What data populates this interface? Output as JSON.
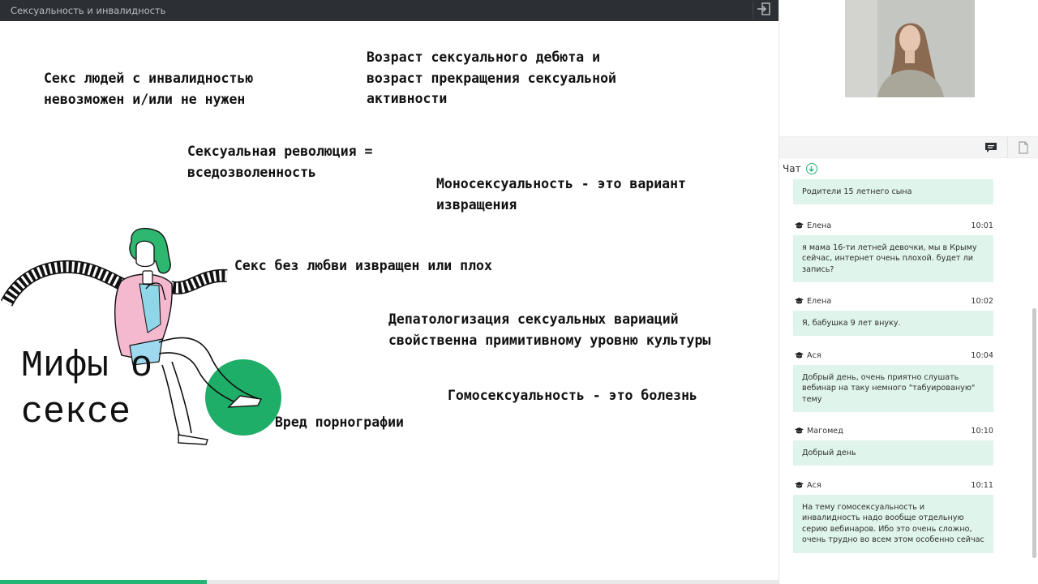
{
  "app": {
    "title": "Сексуальность и инвалидность"
  },
  "slide": {
    "heading": "Мифы о\nсексе",
    "myths": [
      "Секс людей с инвалидностью\nневозможен и/или не нужен",
      "Возраст сексуального дебюта и\nвозраст прекращения сексуальной\nактивности",
      "Сексуальная революция =\nвседозволенность",
      "Моносексуальность - это вариант\nизвращения",
      "Секс без любви извращен или плох",
      "Депатологизация сексуальных вариаций\nсвойственна примитивному уровню культуры",
      "Гомосексуальность - это болезнь",
      "Вред порнографии"
    ],
    "progress": 0.266
  },
  "sidebar": {
    "chat_label": "Чат",
    "tabs": {
      "chat_icon": "chat-icon",
      "files_icon": "file-icon"
    },
    "messages": [
      {
        "author": "",
        "time": "",
        "text": "Родители 15 летнего сына"
      },
      {
        "author": "Елена",
        "time": "10:01",
        "text": "я мама 16-ти летней девочки, мы в Крыму сейчас, интернет очень плохой. будет ли запись?"
      },
      {
        "author": "Елена",
        "time": "10:02",
        "text": "Я, бабушка 9 лет внуку."
      },
      {
        "author": "Ася",
        "time": "10:04",
        "text": "Добрый день, очень приятно слушать вебинар на таку немного \"табуированую\" тему"
      },
      {
        "author": "Магомед",
        "time": "10:10",
        "text": "Добрый день"
      },
      {
        "author": "Ася",
        "time": "10:11",
        "text": "На тему гомосексуальность и инвалидность надо вообще отдельную серию вебинаров. Ибо это очень сложно, очень трудно во всем этом особенно сейчас"
      }
    ]
  },
  "colors": {
    "accent": "#22b573",
    "bubble": "#dff4ea",
    "topbar": "#2c3034"
  }
}
